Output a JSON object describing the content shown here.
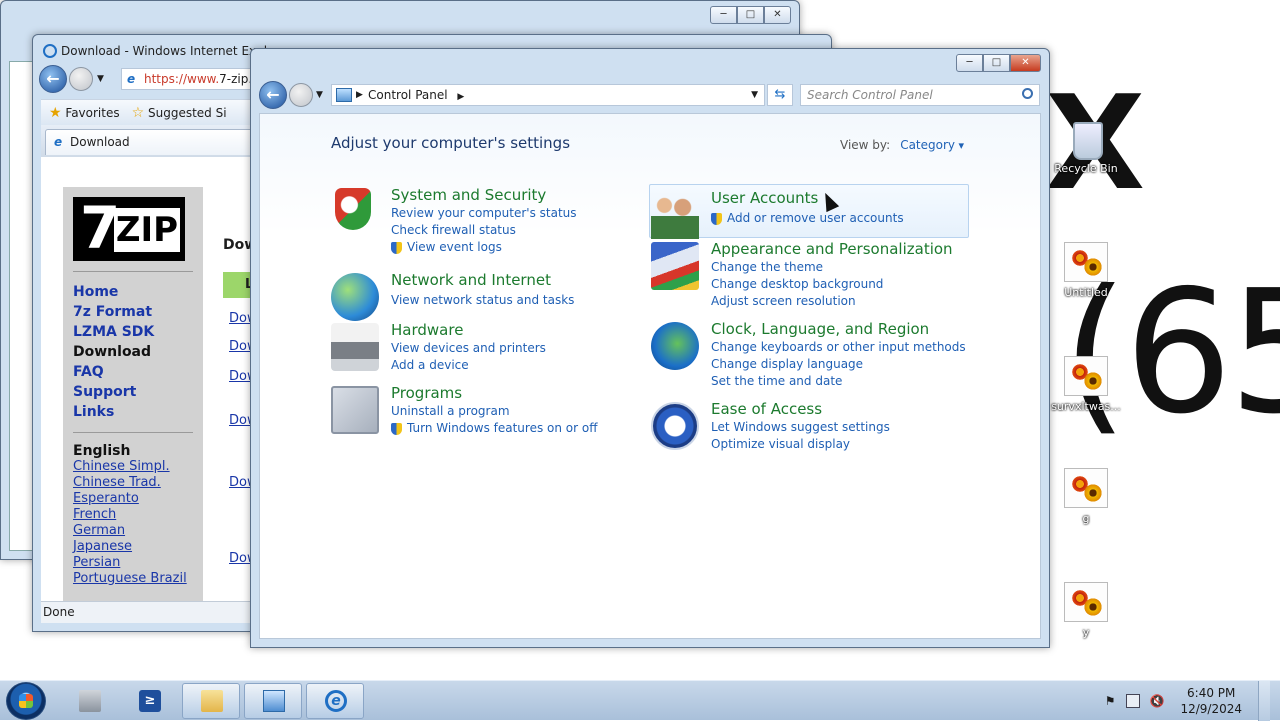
{
  "desktop": {
    "graffiti_x": "X",
    "graffiti_65": "(65",
    "icons": [
      {
        "label": "Recycle Bin",
        "icon": "recycle-bin-icon"
      },
      {
        "label": "Untitled",
        "icon": "image-file-icon"
      },
      {
        "label": "survxltwas...",
        "icon": "image-file-icon"
      },
      {
        "label": "g",
        "icon": "image-file-icon"
      },
      {
        "label": "y",
        "icon": "image-file-icon"
      }
    ]
  },
  "ie_window": {
    "title": "Download - Windows Internet Explo",
    "address_https": "https://www.",
    "address_host": "7-zip.c",
    "favorites_label": "Favorites",
    "suggested_label": "Suggested Si",
    "tab_label": "Download",
    "status": "Done",
    "page": {
      "nav": [
        "Home",
        "7z Format",
        "LZMA SDK",
        "Download",
        "FAQ",
        "Support",
        "Links"
      ],
      "current_nav": "Download",
      "lang_heading": "English",
      "languages": [
        "Chinese Simpl.",
        "Chinese Trad.",
        "Esperanto",
        "French",
        "German",
        "Japanese",
        "Persian",
        "Portuguese Brazil"
      ],
      "main_heading": "Dow",
      "green_cell": "L",
      "download_links": [
        "Dow",
        "Dow",
        "Dow",
        "Dow",
        "Dow",
        "Dow"
      ]
    }
  },
  "control_panel": {
    "breadcrumb": "Control Panel",
    "search_placeholder": "Search Control Panel",
    "heading": "Adjust your computer's settings",
    "view_by_label": "View by:",
    "view_by_value": "Category",
    "categories_left": [
      {
        "title": "System and Security",
        "icon": "shield-icon",
        "links": [
          "Review your computer's status",
          "Check firewall status",
          "View event logs"
        ]
      },
      {
        "title": "Network and Internet",
        "icon": "globe-icon",
        "links": [
          "View network status and tasks"
        ]
      },
      {
        "title": "Hardware",
        "icon": "printer-icon",
        "links": [
          "View devices and printers",
          "Add a device"
        ]
      },
      {
        "title": "Programs",
        "icon": "programs-icon",
        "links": [
          "Uninstall a program",
          "Turn Windows features on or off"
        ]
      }
    ],
    "categories_right": [
      {
        "title": "User Accounts",
        "icon": "users-icon",
        "links": [
          "Add or remove user accounts"
        ]
      },
      {
        "title": "Appearance and Personalization",
        "icon": "appearance-icon",
        "links": [
          "Change the theme",
          "Change desktop background",
          "Adjust screen resolution"
        ]
      },
      {
        "title": "Clock, Language, and Region",
        "icon": "clock-globe-icon",
        "links": [
          "Change keyboards or other input methods",
          "Change display language",
          "Set the time and date"
        ]
      },
      {
        "title": "Ease of Access",
        "icon": "ease-of-access-icon",
        "links": [
          "Let Windows suggest settings",
          "Optimize visual display"
        ]
      }
    ]
  },
  "taskbar": {
    "time": "6:40 PM",
    "date": "12/9/2024",
    "powershell_glyph": "≥"
  }
}
